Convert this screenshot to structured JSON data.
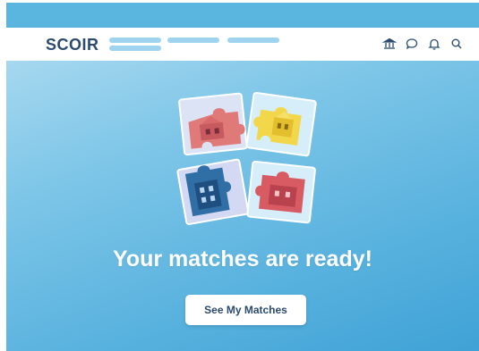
{
  "navbar": {
    "logo_text": "SCOIR",
    "icons": [
      "institution-icon",
      "chat-bubble-icon",
      "bell-icon",
      "search-icon"
    ]
  },
  "hero": {
    "headline": "Your matches are ready!",
    "cta_label": "See My Matches"
  },
  "colors": {
    "brand_dark": "#2b4b6e",
    "hero_blue": "#5bb6df",
    "placeholder_blue": "#9fd4f0"
  }
}
